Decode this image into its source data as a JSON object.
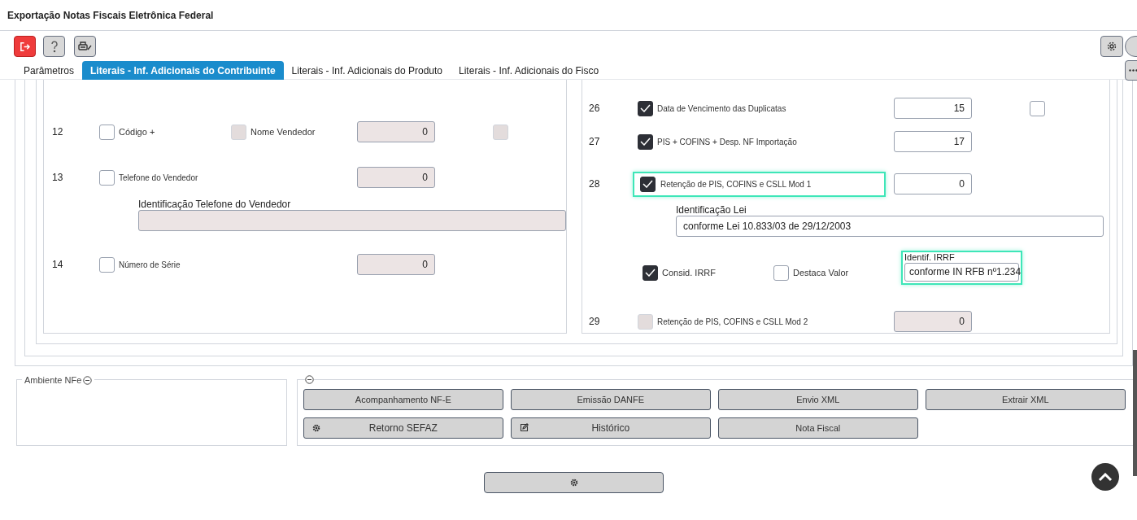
{
  "window": {
    "title": "Exportação Notas Fiscais Eletrônica Federal"
  },
  "tabs": [
    {
      "label": "Parâmetros",
      "selected": false
    },
    {
      "label": "Literais - Inf. Adicionais do Contribuinte",
      "selected": true
    },
    {
      "label": "Literais - Inf. Adicionais do Produto",
      "selected": false
    },
    {
      "label": "Literais - Inf. Adicionais do Fisco",
      "selected": false
    }
  ],
  "left_rows": [
    {
      "kind": "check_row",
      "number": "12",
      "checkbox": {
        "label": "Código +",
        "checked": false,
        "disabled": false
      },
      "checkbox_2": {
        "label": "Nome Vendedor",
        "checked": false,
        "disabled": true
      },
      "value": "0",
      "value_disabled": true,
      "extra_checkbox": {
        "checked": false,
        "disabled": true
      }
    },
    {
      "kind": "check_row",
      "number": "13",
      "checkbox": {
        "label": "Telefone do Vendedor",
        "checked": false,
        "disabled": false
      },
      "value": "0",
      "value_disabled": true
    },
    {
      "kind": "text_field",
      "label": "Identificação Telefone do Vendedor",
      "disabled": true
    },
    {
      "kind": "check_row",
      "number": "14",
      "checkbox": {
        "label": "Número de Série",
        "checked": false,
        "disabled": false
      },
      "value": "0",
      "value_disabled": true
    }
  ],
  "right_rows": [
    {
      "kind": "check_row",
      "number": "26",
      "checkbox": {
        "label": "Data de Vencimento das Duplicatas",
        "checked": true,
        "disabled": false
      },
      "value": "15",
      "value_disabled": false,
      "extra_checkbox": {
        "checked": false,
        "disabled": false
      }
    },
    {
      "kind": "check_row",
      "number": "27",
      "checkbox": {
        "label": "PIS + COFINS + Desp. NF Importação",
        "checked": true,
        "disabled": false
      },
      "value": "17",
      "value_disabled": false
    },
    {
      "kind": "check_row",
      "number": "28",
      "checkbox": {
        "label": "Retenção de PIS, COFINS e CSLL Mod 1",
        "checked": true,
        "disabled": false
      },
      "highlighted": true,
      "value": "0",
      "value_disabled": false
    },
    {
      "kind": "text_field",
      "label": "Identificação Lei",
      "value": "conforme Lei 10.833/03 de 29/12/2003",
      "disabled": false
    },
    {
      "kind": "options_row",
      "checkboxes": [
        {
          "label": "Consid. IRRF",
          "checked": true,
          "disabled": false
        },
        {
          "label": "Destaca Valor",
          "checked": false,
          "disabled": false
        }
      ],
      "field": {
        "label": "Identif. IRRF",
        "value": "conforme IN RFB nº1.234",
        "highlighted": true
      }
    },
    {
      "kind": "check_row",
      "number": "29",
      "checkbox": {
        "label": "Retenção de PIS, COFINS e CSLL Mod 2",
        "checked": false,
        "disabled": true
      },
      "value": "0",
      "value_disabled": true
    }
  ],
  "environment_panel": {
    "legend": "Ambiente NFe"
  },
  "actions": [
    {
      "label": "Acompanhamento NF-E"
    },
    {
      "label": "Emissão DANFE"
    },
    {
      "label": "Envio XML"
    },
    {
      "label": "Extrair XML"
    },
    {
      "label": "Retorno SEFAZ",
      "kind": "gear"
    },
    {
      "label": "Histórico",
      "kind": "edit"
    },
    {
      "label": "Nota Fiscal"
    }
  ]
}
